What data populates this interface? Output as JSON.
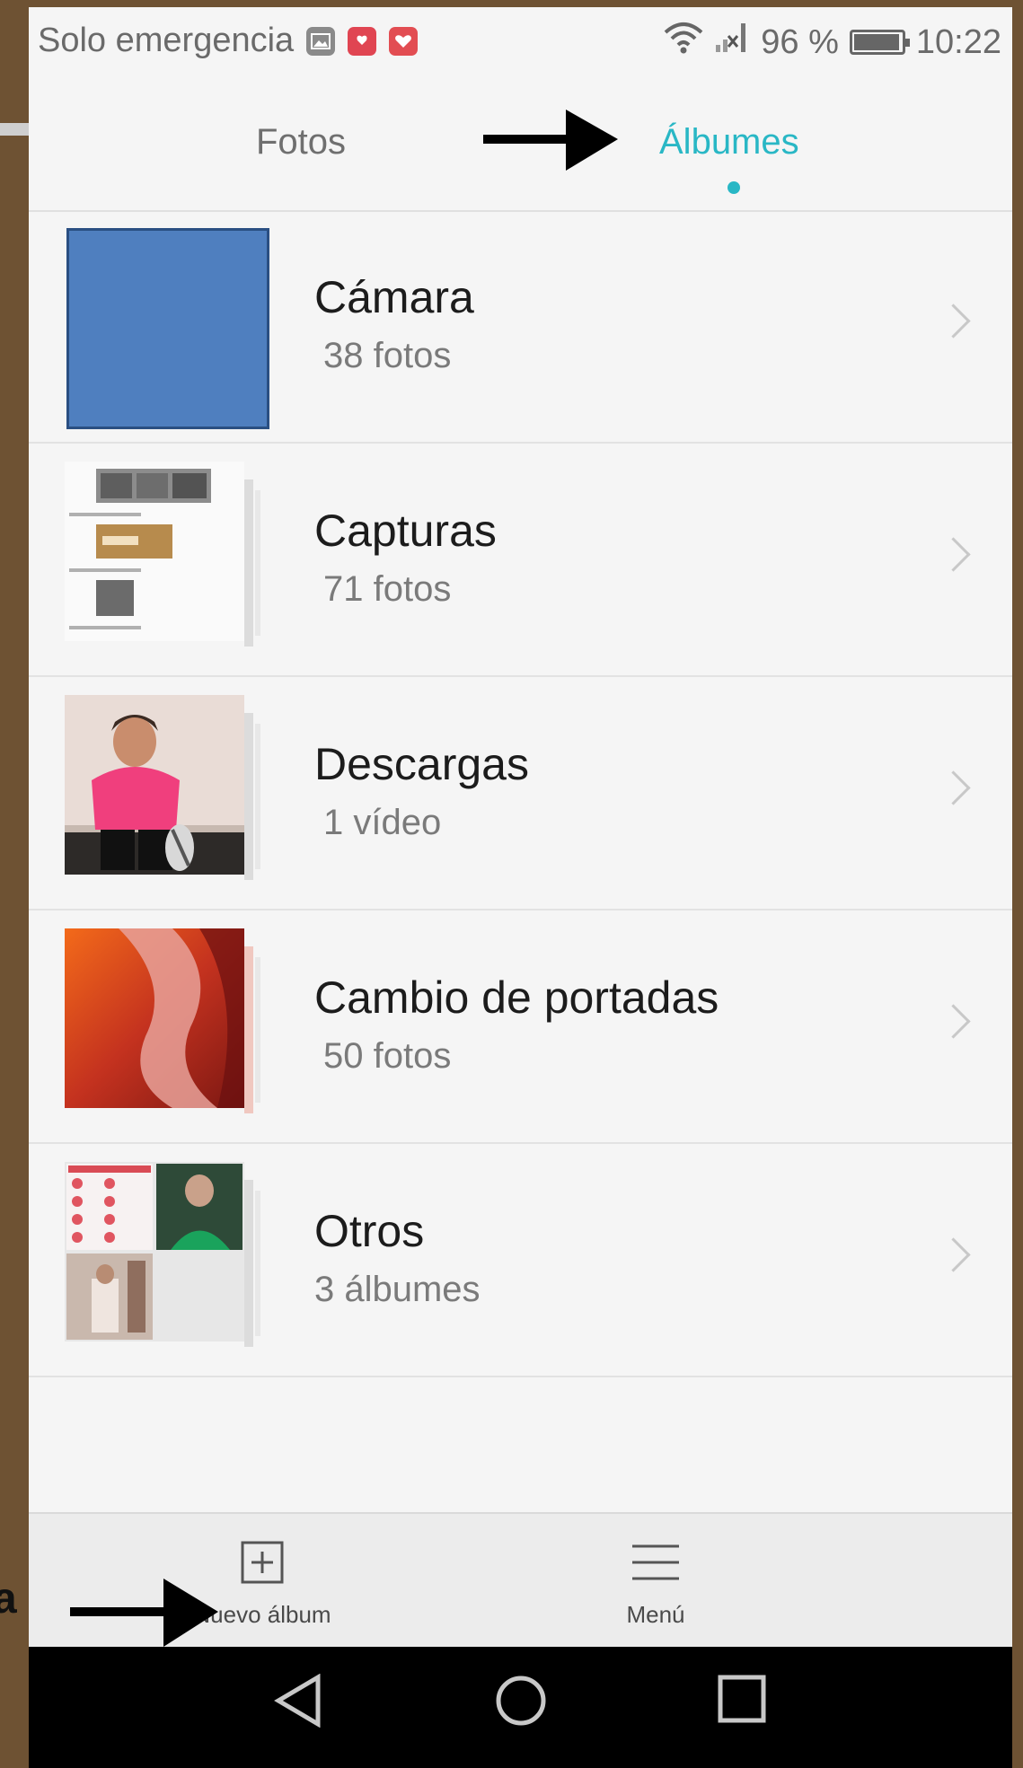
{
  "status_bar": {
    "carrier": "Solo emergencia",
    "battery_percent": "96 %",
    "battery_level": 0.96,
    "time": "10:22",
    "icons": [
      "gallery-notification-icon",
      "huawei-app-icon",
      "heart-app-icon",
      "wifi-icon",
      "no-signal-icon",
      "battery-icon"
    ]
  },
  "tabs": [
    {
      "label": "Fotos",
      "active": false
    },
    {
      "label": "Álbumes",
      "active": true
    }
  ],
  "albums": [
    {
      "title": "Cámara",
      "count": "38 fotos",
      "thumb": "solid-blue"
    },
    {
      "title": "Capturas",
      "count": "71 fotos",
      "thumb": "screenshots"
    },
    {
      "title": "Descargas",
      "count": "1 vídeo",
      "thumb": "person-pink-shirt"
    },
    {
      "title": "Cambio de portadas",
      "count": "50 fotos",
      "thumb": "red-canyon"
    },
    {
      "title": "Otros",
      "count": "3 álbumes",
      "thumb": "collage"
    }
  ],
  "toolbar": {
    "new_album": "Nuevo álbum",
    "menu": "Menú"
  },
  "colors": {
    "accent": "#29b7c5",
    "background": "#f5f5f5",
    "frame": "#6e5233"
  },
  "overlay": {
    "edge_letter": "a"
  }
}
